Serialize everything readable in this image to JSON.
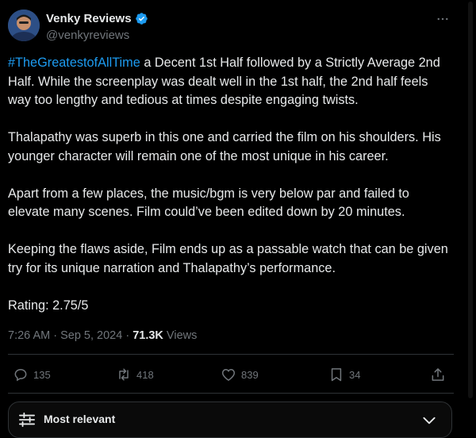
{
  "author": {
    "display_name": "Venky Reviews",
    "handle": "@venkyreviews",
    "verified": true
  },
  "tweet": {
    "hashtag": "#TheGreatestofAllTime",
    "p1_rest": " a Decent 1st Half followed by a Strictly Average 2nd Half. While the screenplay was dealt well in the 1st half, the 2nd half feels way too lengthy and tedious at times despite engaging twists.",
    "p2": "Thalapathy was superb in this one and carried the film on his shoulders. His younger character will remain one of the most unique in his career.",
    "p3": "Apart from a few places, the music/bgm is very below par and failed to elevate many scenes. Film could’ve been edited down by 20 minutes.",
    "p4": "Keeping the flaws aside, Film ends up as a passable watch that can be given try for its unique narration and Thalapathy’s performance.",
    "p5": "Rating: 2.75/5"
  },
  "meta": {
    "time": "7:26 AM",
    "separator": " · ",
    "date": "Sep 5, 2024",
    "views_count": "71.3K",
    "views_label": " Views"
  },
  "actions": {
    "replies": "135",
    "reposts": "418",
    "likes": "839",
    "bookmarks": "34"
  },
  "sort": {
    "label": "Most relevant"
  },
  "colors": {
    "accent": "#1d9bf0",
    "text": "#e7e9ea",
    "muted": "#71767b",
    "border": "#2f3336",
    "background": "#000000"
  },
  "icons": {
    "more": "more-horizontal-icon",
    "reply": "reply-icon",
    "repost": "repost-icon",
    "like": "heart-icon",
    "bookmark": "bookmark-icon",
    "share": "share-icon",
    "sort": "sliders-icon",
    "chevron": "chevron-down-icon",
    "verified": "verified-badge-icon"
  }
}
